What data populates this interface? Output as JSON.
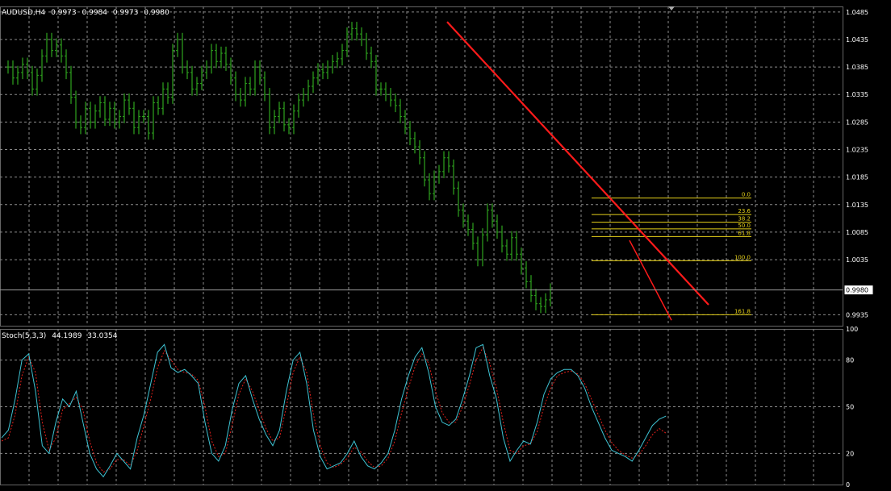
{
  "header": {
    "symbol": "AUDUSD,H4",
    "open": "0.9973",
    "high": "0.9984",
    "low": "0.9973",
    "close": "0.9980"
  },
  "stoch_header": {
    "name": "Stoch(5,3,3)",
    "main": "44.1989",
    "signal": "33.0354"
  },
  "colors": {
    "background": "#000000",
    "grid": "#8a8a8a",
    "candles": "#2fa51f",
    "trendline": "#ff1b1b",
    "fibo": "#e6d11a",
    "stoch_main": "#3ec3d3",
    "stoch_signal": "#e0201b",
    "text": "#ffffff"
  },
  "chart_data": [
    {
      "type": "line",
      "description_of_marks": "candlestick bars",
      "title": "AUDUSD,H4",
      "ylim": [
        0.9915,
        1.0495
      ],
      "y_ticks": [
        "1.0485",
        "1.0435",
        "1.0385",
        "1.0335",
        "1.0285",
        "1.0235",
        "1.0185",
        "1.0135",
        "1.0085",
        "1.0035",
        "0.9980",
        "0.9935"
      ],
      "current_price": "0.9980",
      "current_price_value": 0.998,
      "x": [
        0,
        6,
        12,
        18,
        24,
        30,
        36,
        42,
        48,
        54,
        60,
        66,
        72,
        78,
        84,
        90,
        96,
        102,
        108,
        114,
        120,
        126,
        132,
        138,
        144,
        150,
        156,
        162,
        168,
        174,
        180,
        186,
        192,
        198,
        204,
        210,
        216,
        222,
        228,
        234,
        240,
        246,
        252,
        258,
        264,
        270,
        276,
        282,
        288,
        294,
        300,
        306,
        312,
        318,
        324,
        330,
        336,
        342,
        348,
        354,
        360,
        366,
        372,
        378,
        384,
        390,
        396,
        402,
        408,
        414,
        420,
        426,
        432,
        438,
        444,
        450,
        456,
        462,
        468,
        474,
        480,
        486,
        492,
        498,
        504,
        510,
        516,
        522,
        528,
        534,
        540,
        546,
        552,
        558,
        564,
        570,
        576,
        582,
        588,
        594,
        600,
        606,
        612,
        618,
        624,
        630,
        636,
        642,
        648,
        654,
        660,
        666,
        672,
        678,
        684,
        690,
        696,
        702,
        708,
        714,
        720,
        726,
        732,
        738,
        744,
        750,
        756,
        762,
        768,
        774,
        780,
        786,
        792,
        798,
        804,
        810,
        816,
        822
      ],
      "values": [
        1.0385,
        1.0365,
        1.0375,
        1.039,
        1.0375,
        1.0345,
        1.037,
        1.0405,
        1.0435,
        1.0415,
        1.0425,
        1.0405,
        1.0375,
        1.033,
        1.0285,
        1.0275,
        1.031,
        1.0285,
        1.0305,
        1.032,
        1.029,
        1.031,
        1.0285,
        1.0295,
        1.0325,
        1.031,
        1.0275,
        1.0295,
        1.0295,
        1.0265,
        1.032,
        1.031,
        1.0345,
        1.033,
        1.0415,
        1.0435,
        1.0385,
        1.0375,
        1.0345,
        1.0355,
        1.0375,
        1.0385,
        1.0415,
        1.0395,
        1.041,
        1.039,
        1.0365,
        1.0335,
        1.0325,
        1.0355,
        1.0345,
        1.0385,
        1.0365,
        1.0335,
        1.0275,
        1.0295,
        1.031,
        1.028,
        1.0275,
        1.0305,
        1.0325,
        1.0335,
        1.035,
        1.0365,
        1.038,
        1.0375,
        1.0385,
        1.0395,
        1.04,
        1.0415,
        1.0445,
        1.0455,
        1.0445,
        1.0435,
        1.041,
        1.0395,
        1.0345,
        1.0345,
        1.0335,
        1.0325,
        1.0315,
        1.0295,
        1.0275,
        1.0255,
        1.024,
        1.022,
        1.018,
        1.0155,
        1.0185,
        1.0195,
        1.022,
        1.0205,
        1.0165,
        1.0125,
        1.0105,
        1.009,
        1.0065,
        1.0035,
        1.008,
        1.0125,
        1.0105,
        1.0085,
        1.006,
        1.0045,
        1.0075,
        1.0045,
        1.002,
        0.9995,
        0.997,
        0.9955,
        0.995,
        0.9962,
        0.998
      ]
    },
    {
      "type": "line",
      "title": "Stoch(5,3,3)",
      "ylim": [
        0,
        100
      ],
      "y_ticks": [
        "100",
        "80",
        "50",
        "20",
        "0"
      ],
      "levels": [
        80,
        50,
        20
      ],
      "series": [
        {
          "name": "44.1989",
          "values": [
            30,
            35,
            55,
            80,
            84,
            60,
            25,
            20,
            40,
            55,
            50,
            60,
            40,
            20,
            10,
            5,
            12,
            20,
            15,
            10,
            30,
            45,
            65,
            85,
            90,
            75,
            72,
            74,
            70,
            65,
            40,
            20,
            15,
            25,
            48,
            65,
            70,
            55,
            42,
            32,
            25,
            35,
            60,
            80,
            85,
            65,
            35,
            18,
            10,
            12,
            14,
            20,
            28,
            18,
            12,
            10,
            14,
            20,
            35,
            55,
            70,
            82,
            88,
            72,
            50,
            40,
            38,
            42,
            55,
            70,
            88,
            90,
            70,
            55,
            30,
            15,
            22,
            28,
            26,
            40,
            58,
            68,
            72,
            74,
            74,
            70,
            62,
            50,
            40,
            30,
            22,
            20,
            18,
            15,
            22,
            30,
            38,
            42,
            44
          ]
        },
        {
          "name": "33.0354",
          "values": [
            28,
            30,
            45,
            70,
            82,
            72,
            40,
            22,
            30,
            48,
            52,
            56,
            48,
            28,
            14,
            8,
            10,
            16,
            16,
            12,
            22,
            38,
            55,
            75,
            86,
            80,
            74,
            72,
            71,
            67,
            50,
            28,
            18,
            20,
            38,
            58,
            68,
            60,
            48,
            36,
            28,
            30,
            50,
            72,
            82,
            72,
            45,
            25,
            14,
            11,
            13,
            17,
            24,
            21,
            15,
            11,
            12,
            17,
            28,
            46,
            62,
            76,
            84,
            78,
            60,
            46,
            40,
            40,
            50,
            64,
            80,
            88,
            78,
            62,
            40,
            22,
            20,
            25,
            26,
            34,
            50,
            62,
            70,
            72,
            73,
            71,
            65,
            55,
            45,
            35,
            27,
            22,
            19,
            17,
            19,
            25,
            32,
            36,
            33
          ]
        }
      ]
    }
  ],
  "fibo": [
    {
      "label": "0.0",
      "price": 1.0147
    },
    {
      "label": "23.6",
      "price": 1.0117
    },
    {
      "label": "38.2",
      "price": 1.0103
    },
    {
      "label": "50.0",
      "price": 1.0091
    },
    {
      "label": "61.8",
      "price": 1.0077
    },
    {
      "label": "100.0",
      "price": 1.0033
    },
    {
      "label": "161.8",
      "price": 0.9935
    }
  ]
}
